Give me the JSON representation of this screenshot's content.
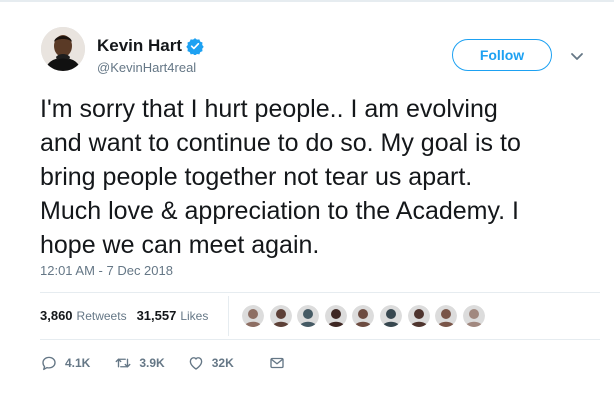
{
  "tweet": {
    "author": {
      "display_name": "Kevin Hart",
      "handle": "@KevinHart4real",
      "verified": true,
      "avatar_icon": "avatar-kevin-hart"
    },
    "follow_label": "Follow",
    "more_icon": "chevron-down-icon",
    "text": "I'm sorry that I hurt people.. I am evolving\nand want to continue to do so. My goal is to\nbring people together not tear us apart.\nMuch love & appreciation to the Academy.  I\nhope we can meet again.",
    "timestamp": "12:01 AM - 7 Dec 2018",
    "stats": {
      "retweets_count": "3,860",
      "retweets_label": "Retweets",
      "likes_count": "31,557",
      "likes_label": "Likes"
    },
    "likers": [
      {
        "name": "liker-1",
        "color": "#8d6e63"
      },
      {
        "name": "liker-2",
        "color": "#5d4037"
      },
      {
        "name": "liker-3",
        "color": "#455a64"
      },
      {
        "name": "liker-4",
        "color": "#3e2723"
      },
      {
        "name": "liker-5",
        "color": "#6d4c41"
      },
      {
        "name": "liker-6",
        "color": "#37474f"
      },
      {
        "name": "liker-7",
        "color": "#4e342e"
      },
      {
        "name": "liker-8",
        "color": "#795548"
      },
      {
        "name": "liker-9",
        "color": "#a1887f"
      }
    ],
    "actions": {
      "reply_count": "4.1K",
      "retweet_count": "3.9K",
      "like_count": "32K"
    }
  },
  "colors": {
    "accent": "#1da1f2",
    "text": "#14171a",
    "muted": "#657786",
    "divider": "#e6ecf0"
  }
}
